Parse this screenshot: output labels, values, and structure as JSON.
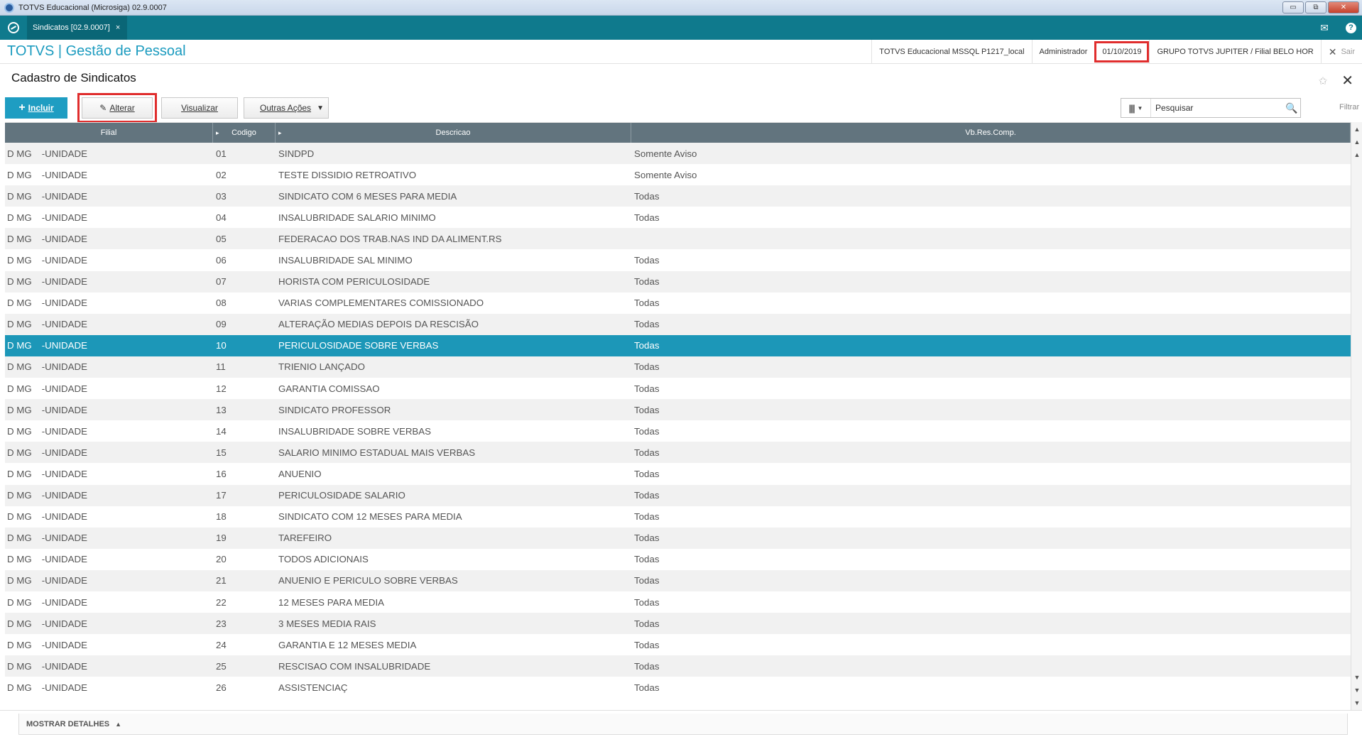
{
  "window": {
    "title": "TOTVS Educacional (Microsiga) 02.9.0007",
    "min": "▭",
    "max": "⧉",
    "close": "✕"
  },
  "tabbar": {
    "tab_label": "Sindicatos [02.9.0007]",
    "tab_close": "×",
    "mail_icon": "✉",
    "help_icon": "?"
  },
  "appbar": {
    "brand": "TOTVS | Gestão de Pessoal",
    "environment": "TOTVS Educacional MSSQL P1217_local",
    "user": "Administrador",
    "date": "01/10/2019",
    "company": "GRUPO TOTVS JUPITER / Filial BELO HOR",
    "exit_icon": "✕",
    "exit_label": "Sair"
  },
  "page": {
    "title": "Cadastro de Sindicatos",
    "gear_icon": "✩",
    "close_icon": "✕"
  },
  "toolbar": {
    "incluir_icon": "+",
    "incluir": "Incluir",
    "alterar_icon": "✎",
    "alterar": "Alterar",
    "visualizar": "Visualizar",
    "outras": "Outras Ações",
    "outras_caret": "▼"
  },
  "search": {
    "cols_icon": "|||",
    "cols_caret": "▼",
    "placeholder": "Pesquisar",
    "search_icon": "🔍",
    "filter_label": "Filtrar"
  },
  "grid": {
    "columns": [
      "Filial",
      "Codigo",
      "Descricao",
      "Vb.Res.Comp."
    ],
    "sort_arrow": "▸",
    "selected_codigo": "10",
    "rows": [
      {
        "uf": "D MG",
        "filial": "-UNIDADE",
        "codigo": "01",
        "descricao": "SINDPD",
        "vb": "Somente Aviso"
      },
      {
        "uf": "D MG",
        "filial": "-UNIDADE",
        "codigo": "02",
        "descricao": "TESTE DISSIDIO RETROATIVO",
        "vb": "Somente Aviso"
      },
      {
        "uf": "D MG",
        "filial": "-UNIDADE",
        "codigo": "03",
        "descricao": "SINDICATO COM 6 MESES PARA MEDIA",
        "vb": "Todas"
      },
      {
        "uf": "D MG",
        "filial": "-UNIDADE",
        "codigo": "04",
        "descricao": "INSALUBRIDADE SALARIO MINIMO",
        "vb": "Todas"
      },
      {
        "uf": "D MG",
        "filial": "-UNIDADE",
        "codigo": "05",
        "descricao": "FEDERACAO DOS TRAB.NAS IND DA ALIMENT.RS",
        "vb": ""
      },
      {
        "uf": "D MG",
        "filial": "-UNIDADE",
        "codigo": "06",
        "descricao": "INSALUBRIDADE SAL MINIMO",
        "vb": "Todas"
      },
      {
        "uf": "D MG",
        "filial": "-UNIDADE",
        "codigo": "07",
        "descricao": "HORISTA COM PERICULOSIDADE",
        "vb": "Todas"
      },
      {
        "uf": "D MG",
        "filial": "-UNIDADE",
        "codigo": "08",
        "descricao": "VARIAS COMPLEMENTARES COMISSIONADO",
        "vb": "Todas"
      },
      {
        "uf": "D MG",
        "filial": "-UNIDADE",
        "codigo": "09",
        "descricao": "ALTERAÇÃO MEDIAS DEPOIS DA RESCISÃO",
        "vb": "Todas"
      },
      {
        "uf": "D MG",
        "filial": "-UNIDADE",
        "codigo": "10",
        "descricao": "PERICULOSIDADE SOBRE VERBAS",
        "vb": "Todas"
      },
      {
        "uf": "D MG",
        "filial": "-UNIDADE",
        "codigo": "11",
        "descricao": "TRIENIO LANÇADO",
        "vb": "Todas"
      },
      {
        "uf": "D MG",
        "filial": "-UNIDADE",
        "codigo": "12",
        "descricao": "GARANTIA COMISSAO",
        "vb": "Todas"
      },
      {
        "uf": "D MG",
        "filial": "-UNIDADE",
        "codigo": "13",
        "descricao": "SINDICATO PROFESSOR",
        "vb": "Todas"
      },
      {
        "uf": "D MG",
        "filial": "-UNIDADE",
        "codigo": "14",
        "descricao": "INSALUBRIDADE SOBRE VERBAS",
        "vb": "Todas"
      },
      {
        "uf": "D MG",
        "filial": "-UNIDADE",
        "codigo": "15",
        "descricao": "SALARIO MINIMO ESTADUAL MAIS VERBAS",
        "vb": "Todas"
      },
      {
        "uf": "D MG",
        "filial": "-UNIDADE",
        "codigo": "16",
        "descricao": "ANUENIO",
        "vb": "Todas"
      },
      {
        "uf": "D MG",
        "filial": "-UNIDADE",
        "codigo": "17",
        "descricao": "PERICULOSIDADE SALARIO",
        "vb": "Todas"
      },
      {
        "uf": "D MG",
        "filial": "-UNIDADE",
        "codigo": "18",
        "descricao": "SINDICATO COM 12 MESES PARA MEDIA",
        "vb": "Todas"
      },
      {
        "uf": "D MG",
        "filial": "-UNIDADE",
        "codigo": "19",
        "descricao": "TAREFEIRO",
        "vb": "Todas"
      },
      {
        "uf": "D MG",
        "filial": "-UNIDADE",
        "codigo": "20",
        "descricao": "TODOS ADICIONAIS",
        "vb": "Todas"
      },
      {
        "uf": "D MG",
        "filial": "-UNIDADE",
        "codigo": "21",
        "descricao": "ANUENIO E PERICULO SOBRE VERBAS",
        "vb": "Todas"
      },
      {
        "uf": "D MG",
        "filial": "-UNIDADE",
        "codigo": "22",
        "descricao": "12 MESES PARA MEDIA",
        "vb": "Todas"
      },
      {
        "uf": "D MG",
        "filial": "-UNIDADE",
        "codigo": "23",
        "descricao": "3 MESES MEDIA RAIS",
        "vb": "Todas"
      },
      {
        "uf": "D MG",
        "filial": "-UNIDADE",
        "codigo": "24",
        "descricao": "GARANTIA E 12 MESES MEDIA",
        "vb": "Todas"
      },
      {
        "uf": "D MG",
        "filial": "-UNIDADE",
        "codigo": "25",
        "descricao": "RESCISAO COM INSALUBRIDADE",
        "vb": "Todas"
      },
      {
        "uf": "D MG",
        "filial": "-UNIDADE",
        "codigo": "26",
        "descricao": "ASSISTENCIAÇ",
        "vb": "Todas"
      }
    ]
  },
  "scroll": {
    "top": "▲",
    "up": "▲",
    "down": "▼",
    "bottom": "▼"
  },
  "footer": {
    "details": "MOSTRAR DETALHES",
    "details_icon": "▲"
  },
  "colors": {
    "accent": "#1e9dc2",
    "tabbar": "#0f7a8d",
    "header": "#62747e",
    "highlight_box": "#e02d2d",
    "selected_row": "#1c97b8"
  }
}
